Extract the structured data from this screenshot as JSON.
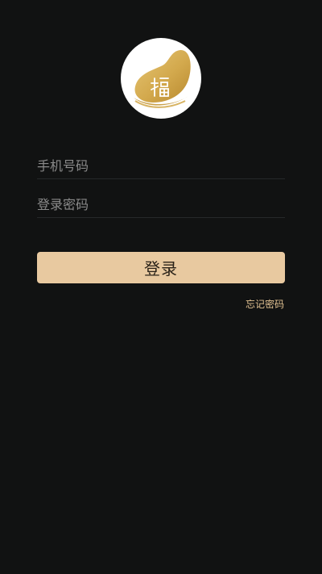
{
  "logo": {
    "icon": "fu-gold-logo-icon",
    "colors": {
      "gold_light": "#e6c675",
      "gold_dark": "#b8892f",
      "bg": "#ffffff"
    }
  },
  "form": {
    "phone_placeholder": "手机号码",
    "phone_value": "",
    "password_placeholder": "登录密码",
    "password_value": ""
  },
  "actions": {
    "login_label": "登录",
    "forgot_label": "忘记密码"
  },
  "theme": {
    "background": "#111212",
    "accent": "#e8c9a0",
    "link": "#e3c393"
  }
}
